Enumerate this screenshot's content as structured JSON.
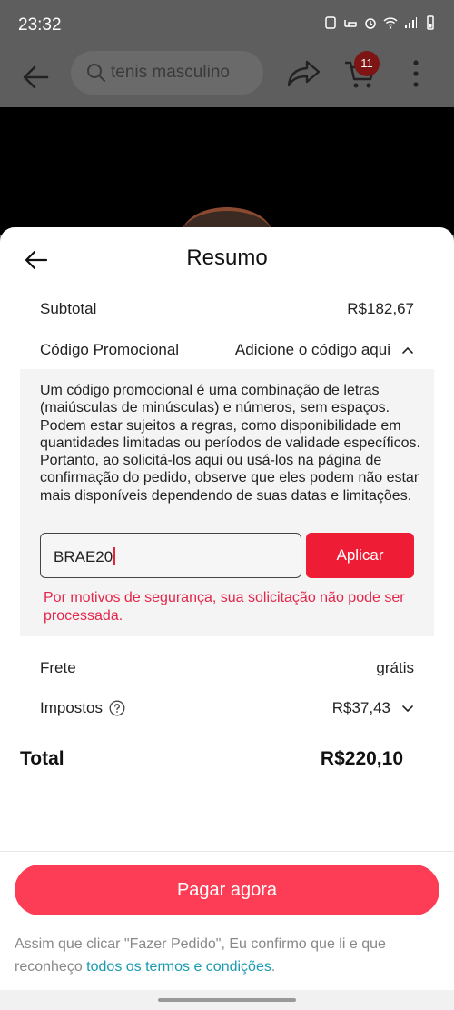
{
  "status_bar": {
    "time": "23:32"
  },
  "app_bar": {
    "search_placeholder": "tenis masculino",
    "cart_count": "11"
  },
  "sheet": {
    "title": "Resumo",
    "subtotal": {
      "label": "Subtotal",
      "value": "R$182,67"
    },
    "promo": {
      "label": "Código Promocional",
      "action": "Adicione o código aqui",
      "description": "Um código promocional é uma combinação de letras (maiúsculas de minúsculas) e números, sem espaços. Podem estar sujeitos a regras, como disponibilidade em quantidades limitadas ou períodos de validade específicos. Portanto, ao solicitá-los aqui ou usá-los na página de confirmação do pedido, observe que eles podem não estar mais disponíveis dependendo de suas datas e limitações.",
      "input_value": "BRAE20",
      "apply_label": "Aplicar",
      "error": "Por motivos de segurança, sua solicitação não pode ser processada."
    },
    "shipping": {
      "label": "Frete",
      "value": "grátis"
    },
    "taxes": {
      "label": "Impostos",
      "value": "R$37,43"
    },
    "total": {
      "label": "Total",
      "value": "R$220,10"
    },
    "pay_button": "Pagar agora",
    "terms_prefix": "Assim que clicar \"Fazer Pedido\", Eu confirmo que li e que reconheço ",
    "terms_link": "todos os termos e condições",
    "terms_suffix": "."
  },
  "colors": {
    "accent_red": "#ee1c34",
    "pay_button": "#fd3c55",
    "error_text": "#e5264a",
    "link": "#1a9ab0"
  }
}
